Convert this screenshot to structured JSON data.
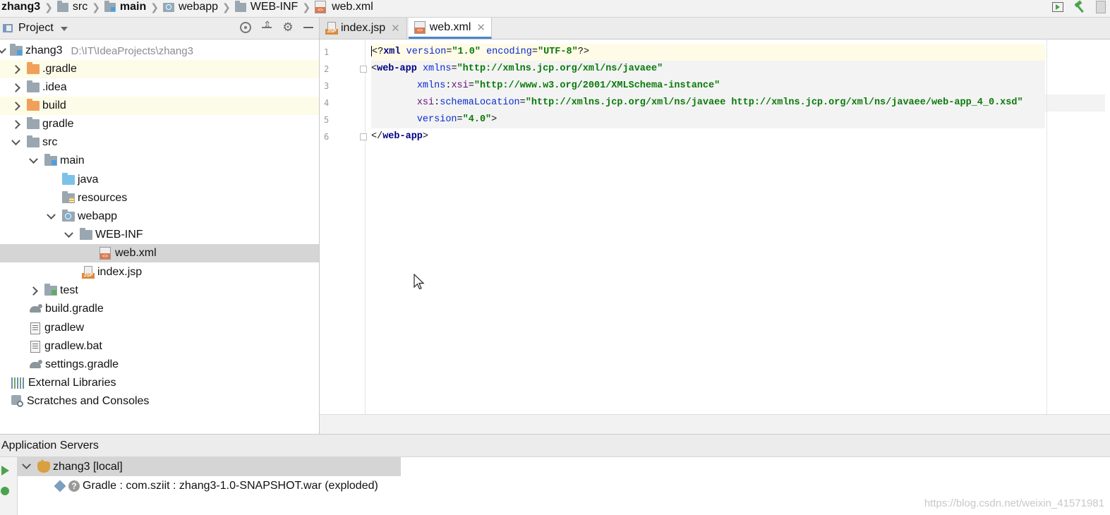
{
  "breadcrumb": {
    "items": [
      {
        "label": "zhang3",
        "icon": "none",
        "bold": true
      },
      {
        "label": "src",
        "icon": "folder-icon",
        "bold": false
      },
      {
        "label": "main",
        "icon": "source-folder-icon",
        "bold": true
      },
      {
        "label": "webapp",
        "icon": "web-folder-icon",
        "bold": false
      },
      {
        "label": "WEB-INF",
        "icon": "folder-icon",
        "bold": false
      },
      {
        "label": "web.xml",
        "icon": "xml-file-icon",
        "bold": false
      }
    ]
  },
  "project_panel": {
    "title": "Project",
    "tree": [
      {
        "label": "zhang3",
        "hint": "D:\\IT\\IdeaProjects\\zhang3"
      },
      {
        "label": ".gradle"
      },
      {
        "label": ".idea"
      },
      {
        "label": "build"
      },
      {
        "label": "gradle"
      },
      {
        "label": "src"
      },
      {
        "label": "main"
      },
      {
        "label": "java"
      },
      {
        "label": "resources"
      },
      {
        "label": "webapp"
      },
      {
        "label": "WEB-INF"
      },
      {
        "label": "web.xml"
      },
      {
        "label": "index.jsp"
      },
      {
        "label": "test"
      },
      {
        "label": "build.gradle"
      },
      {
        "label": "gradlew"
      },
      {
        "label": "gradlew.bat"
      },
      {
        "label": "settings.gradle"
      },
      {
        "label": "External Libraries"
      },
      {
        "label": "Scratches and Consoles"
      }
    ]
  },
  "editor": {
    "tabs": [
      {
        "label": "index.jsp",
        "active": false
      },
      {
        "label": "web.xml",
        "active": true
      }
    ],
    "line_numbers": [
      "1",
      "2",
      "3",
      "4",
      "5",
      "6"
    ],
    "code": {
      "l1": {
        "open": "<?",
        "tag": "xml",
        "a1": "version",
        "eq1": "=",
        "v1": "\"1.0\"",
        "a2": "encoding",
        "eq2": "=",
        "v2": "\"UTF-8\"",
        "close": "?>"
      },
      "l2": {
        "open": "<",
        "tag": "web-app",
        "a1": "xmlns",
        "eq1": "=",
        "v1": "\"http://xmlns.jcp.org/xml/ns/javaee\""
      },
      "l3": {
        "indent": "        ",
        "prefix": "xmlns",
        "colon": ":",
        "a1": "xsi",
        "eq1": "=",
        "v1": "\"http://www.w3.org/2001/XMLSchema-instance\""
      },
      "l4": {
        "indent": "        ",
        "prefix": "xsi",
        "colon": ":",
        "a1": "schemaLocation",
        "eq1": "=",
        "v1": "\"http://xmlns.jcp.org/xml/ns/javaee http://xmlns.jcp.org/xml/ns/javaee/web-app_4_0.xsd\""
      },
      "l5": {
        "indent": "        ",
        "a1": "version",
        "eq1": "=",
        "v1": "\"4.0\"",
        "close": ">"
      },
      "l6": {
        "open": "</",
        "tag": "web-app",
        "close": ">"
      }
    }
  },
  "app_servers": {
    "title": "Application Servers",
    "server": "zhang3 [local]",
    "artifact": "Gradle : com.sziit : zhang3-1.0-SNAPSHOT.war (exploded)"
  },
  "watermark": "https://blog.csdn.net/weixin_41571981",
  "colors": {
    "accent": "#4a86c8",
    "selection": "#d5d5d5",
    "run_green": "#4aa34a"
  }
}
